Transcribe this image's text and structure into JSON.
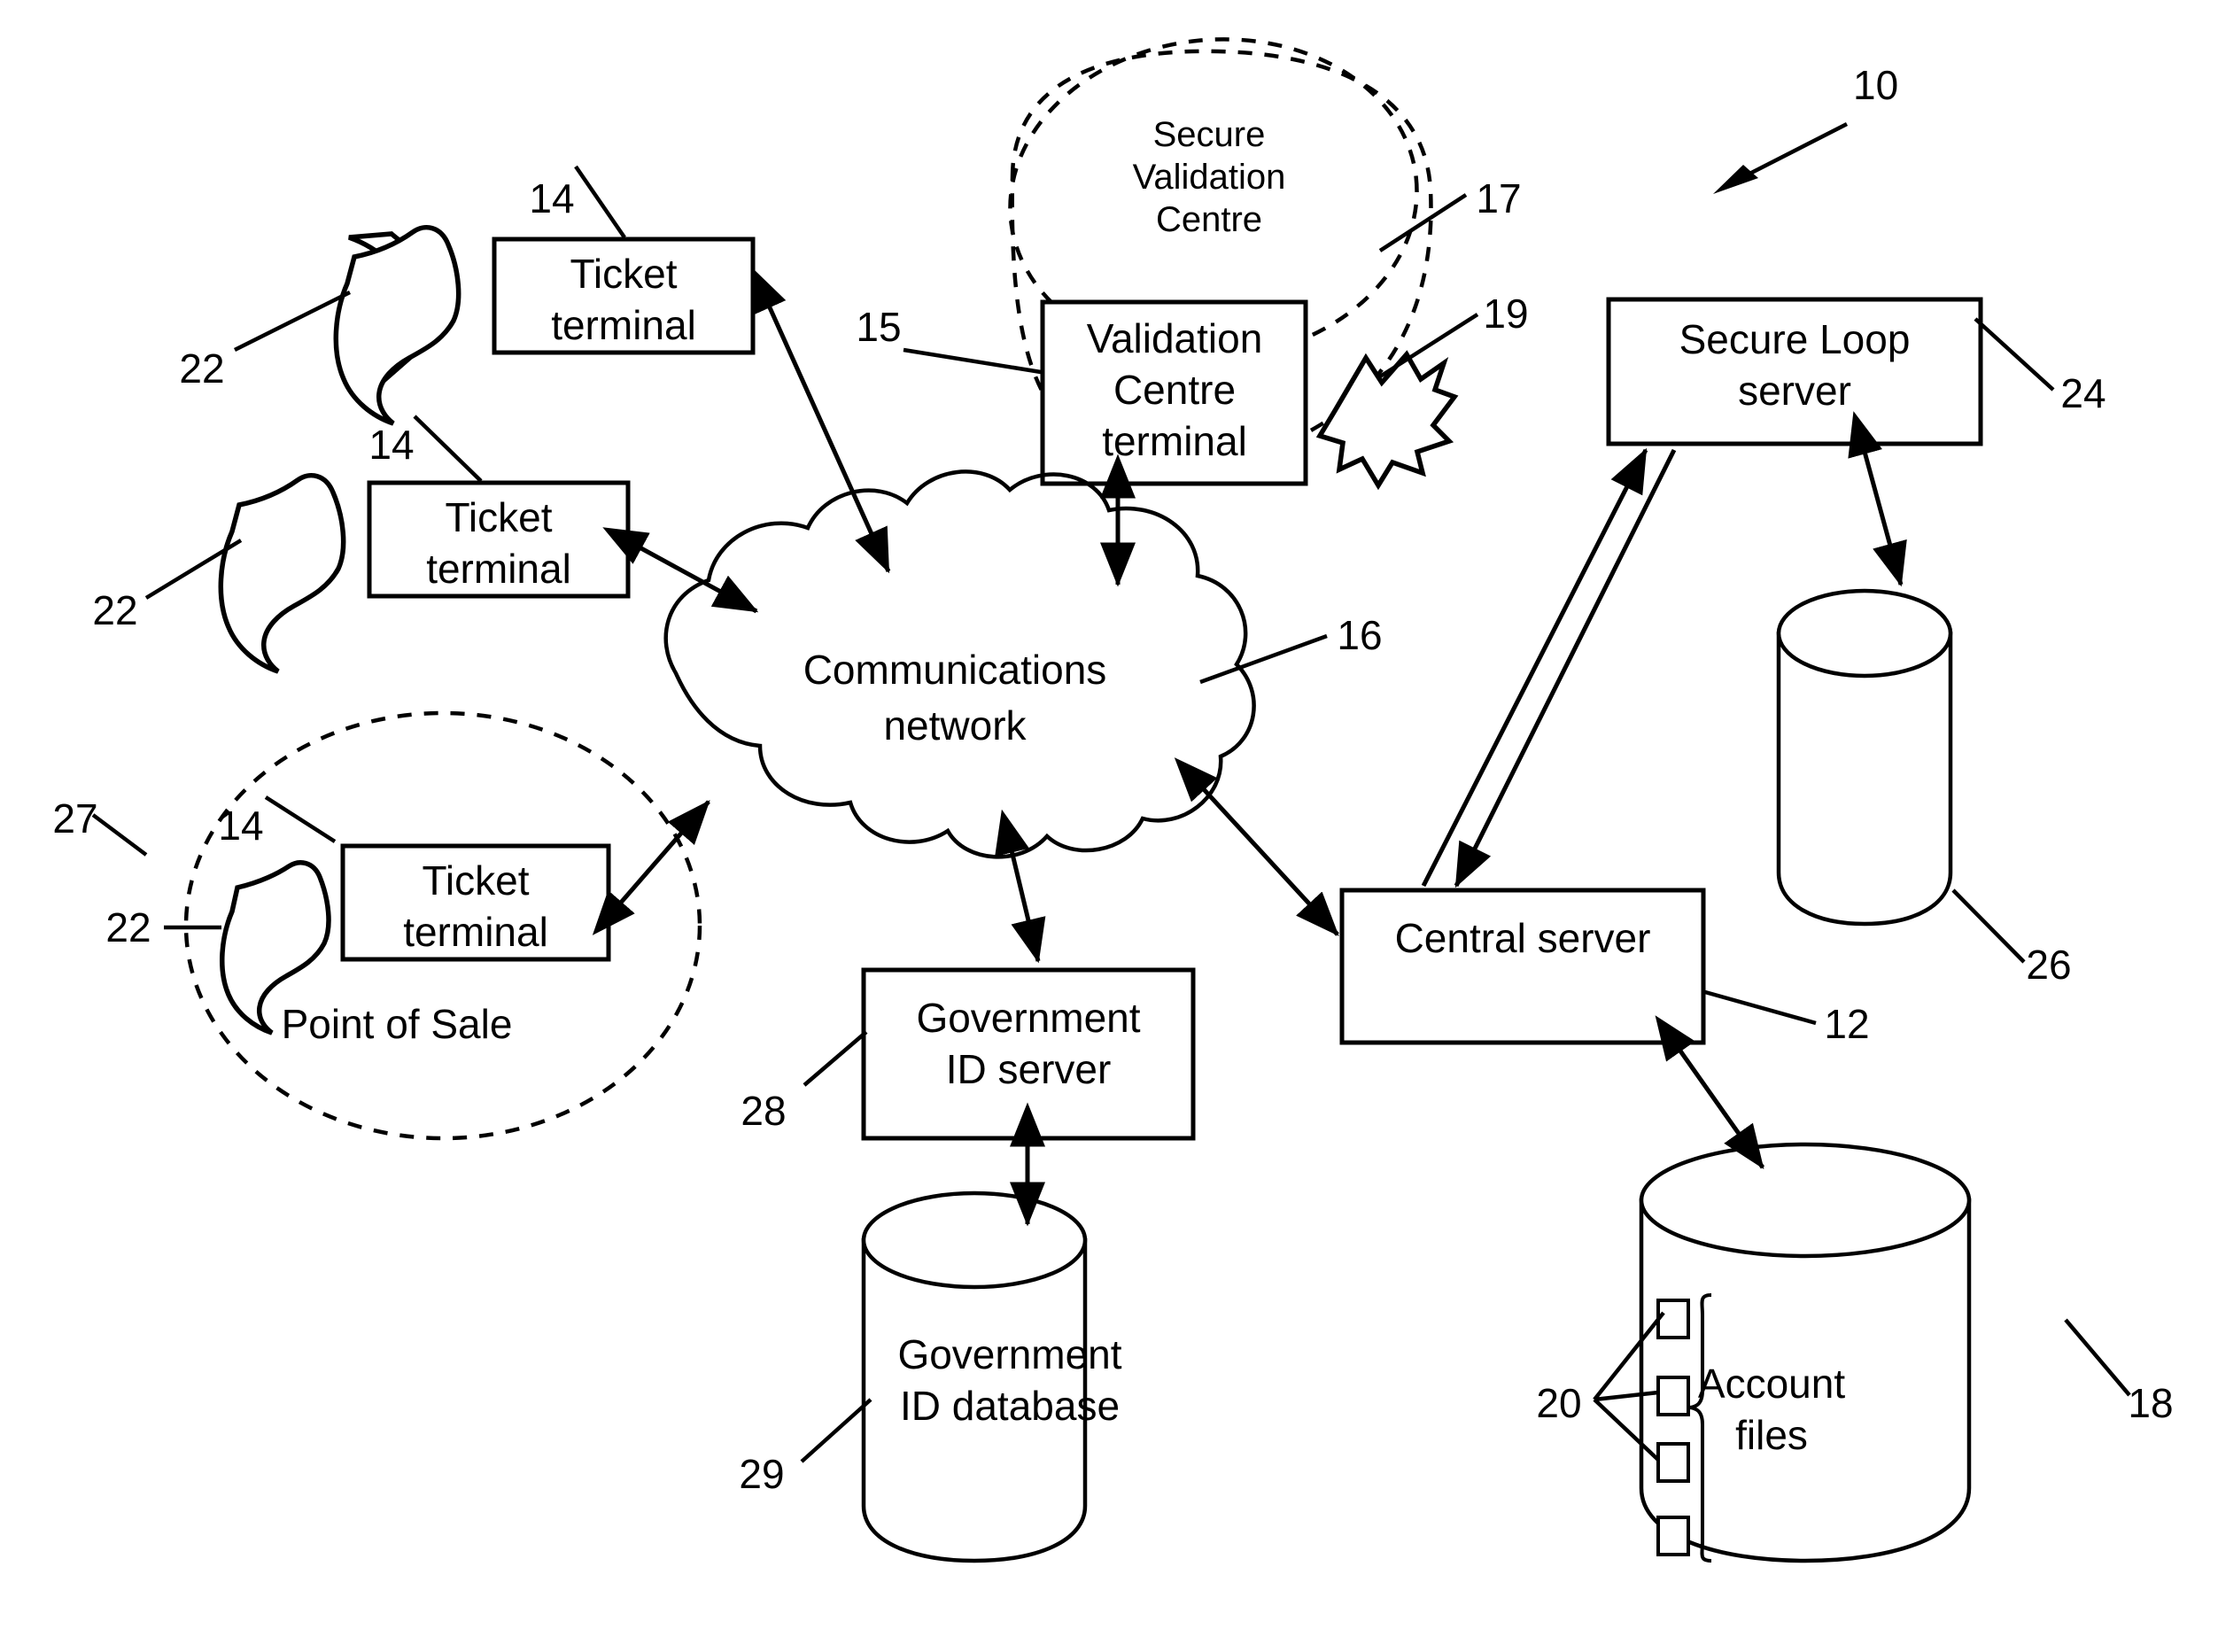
{
  "figure": {
    "type": "patent-system-diagram",
    "title_ref": "10",
    "background": "#ffffff",
    "line_color": "#000000"
  },
  "nodes": {
    "ticket_terminal_1": {
      "label_line1": "Ticket",
      "label_line2": "terminal",
      "ref": "14"
    },
    "ticket_terminal_2": {
      "label_line1": "Ticket",
      "label_line2": "terminal",
      "ref": "14"
    },
    "ticket_terminal_3": {
      "label_line1": "Ticket",
      "label_line2": "terminal",
      "ref": "14"
    },
    "validation_centre_terminal": {
      "label_line1": "Validation",
      "label_line2": "Centre",
      "label_line3": "terminal",
      "ref": "15"
    },
    "communications_network": {
      "label_line1": "Communications",
      "label_line2": "network",
      "ref": "16"
    },
    "secure_loop_server": {
      "label_line1": "Secure Loop",
      "label_line2": "server",
      "ref": "24"
    },
    "central_server": {
      "label_line1": "Central server",
      "ref": "12"
    },
    "government_id_server": {
      "label_line1": "Government",
      "label_line2": "ID server",
      "ref": "28"
    },
    "government_id_database": {
      "label_line1": "Government",
      "label_line2": "ID database",
      "ref": "29"
    },
    "secure_loop_database": {
      "ref": "26"
    },
    "account_files_database": {
      "label_line1": "Account",
      "label_line2": "files",
      "ref": "18",
      "files_ref": "20"
    }
  },
  "regions": {
    "secure_validation_centre": {
      "label_line1": "Secure",
      "label_line2": "Validation",
      "label_line3": "Centre",
      "ref": "17"
    },
    "point_of_sale": {
      "label": "Point of Sale",
      "ref": "27"
    }
  },
  "tickets": [
    {
      "ref": "22",
      "name": "ticket-token-1"
    },
    {
      "ref": "22",
      "name": "ticket-token-2"
    },
    {
      "ref": "22",
      "name": "ticket-token-3"
    },
    {
      "ref": "19",
      "name": "validated-token"
    }
  ],
  "reference_numerals": {
    "system": "10",
    "central_server": "12",
    "ticket_terminal": "14",
    "validation_centre_terminal": "15",
    "communications_network": "16",
    "secure_validation_centre": "17",
    "account_files_database": "18",
    "validated_token": "19",
    "account_files": "20",
    "ticket_token": "22",
    "secure_loop_server": "24",
    "secure_loop_database": "26",
    "point_of_sale": "27",
    "government_id_server": "28",
    "government_id_database": "29"
  }
}
